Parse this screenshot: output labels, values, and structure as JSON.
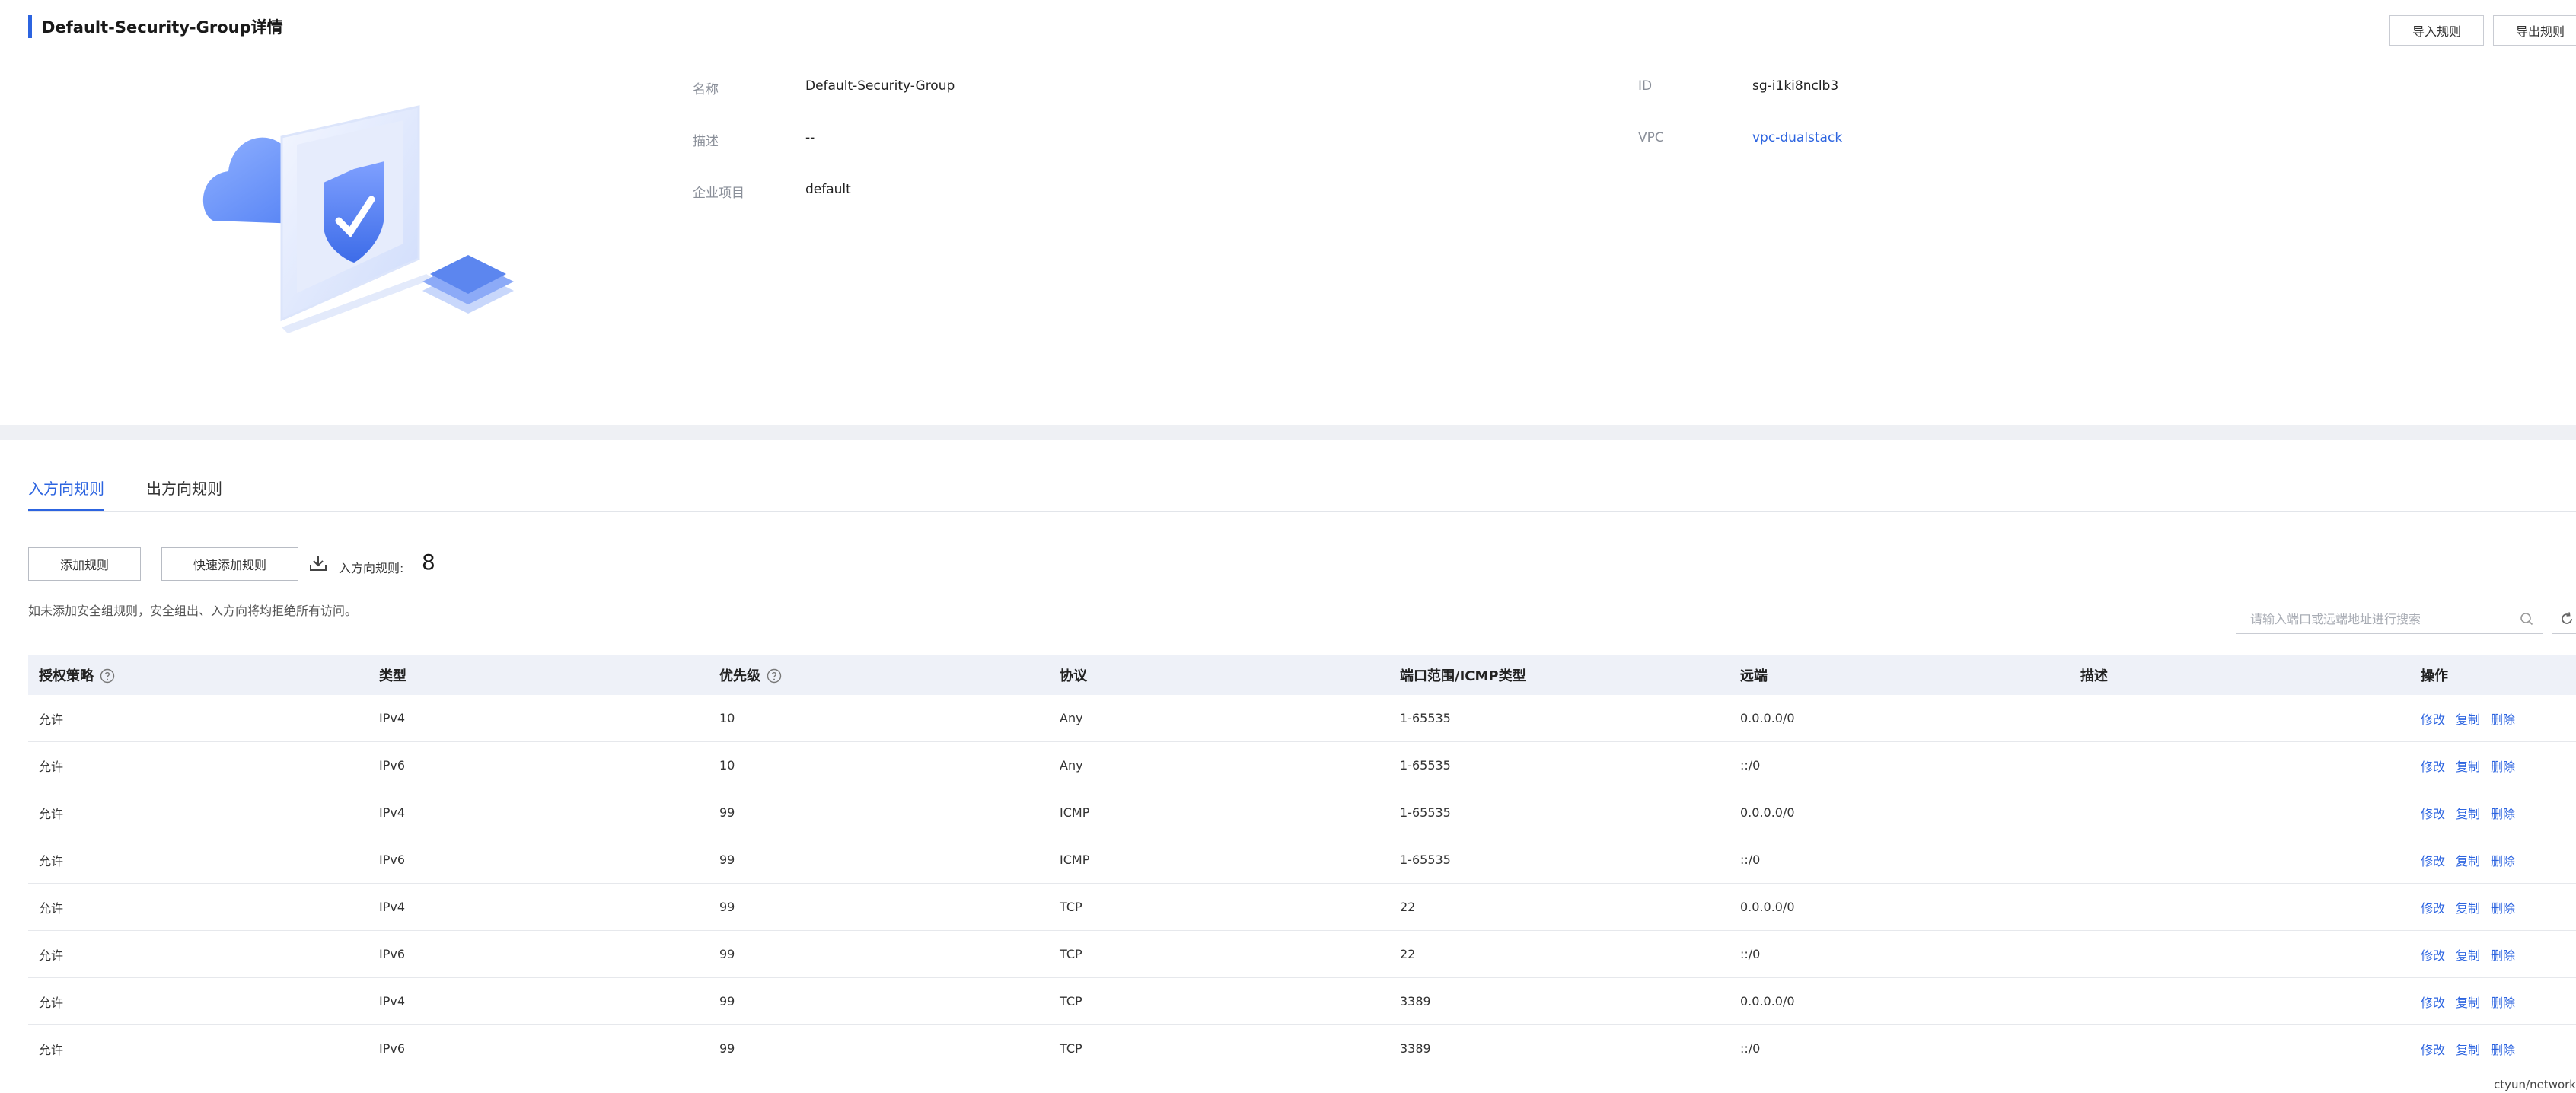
{
  "header": {
    "title": "Default-Security-Group详情",
    "import_label": "导入规则",
    "export_label": "导出规则"
  },
  "details": {
    "name_label": "名称",
    "name_value": "Default-Security-Group",
    "desc_label": "描述",
    "desc_value": "--",
    "project_label": "企业项目",
    "project_value": "default",
    "id_label": "ID",
    "id_value": "sg-i1ki8nclb3",
    "vpc_label": "VPC",
    "vpc_value": "vpc-dualstack"
  },
  "tabs": [
    {
      "label": "入方向规则",
      "active": true
    },
    {
      "label": "出方向规则",
      "active": false
    }
  ],
  "toolbar": {
    "add_label": "添加规则",
    "quick_add_label": "快速添加规则",
    "count_label": "入方向规则:",
    "count_value": "8",
    "hint": "如未添加安全组规则，安全组出、入方向将均拒绝所有访问。",
    "search_placeholder": "请输入端口或远端地址进行搜索"
  },
  "table": {
    "headers": [
      "授权策略",
      "类型",
      "优先级",
      "协议",
      "端口范围/ICMP类型",
      "远端",
      "描述",
      "操作"
    ],
    "ops": [
      "修改",
      "复制",
      "删除"
    ],
    "rows": [
      [
        "允许",
        "IPv4",
        "10",
        "Any",
        "1-65535",
        "0.0.0.0/0",
        ""
      ],
      [
        "允许",
        "IPv6",
        "10",
        "Any",
        "1-65535",
        "::/0",
        ""
      ],
      [
        "允许",
        "IPv4",
        "99",
        "ICMP",
        "1-65535",
        "0.0.0.0/0",
        ""
      ],
      [
        "允许",
        "IPv6",
        "99",
        "ICMP",
        "1-65535",
        "::/0",
        ""
      ],
      [
        "允许",
        "IPv4",
        "99",
        "TCP",
        "22",
        "0.0.0.0/0",
        ""
      ],
      [
        "允许",
        "IPv6",
        "99",
        "TCP",
        "22",
        "::/0",
        ""
      ],
      [
        "允许",
        "IPv4",
        "99",
        "TCP",
        "3389",
        "0.0.0.0/0",
        ""
      ],
      [
        "允许",
        "IPv6",
        "99",
        "TCP",
        "3389",
        "::/0",
        ""
      ]
    ]
  },
  "footer": {
    "text": "ctyun/network"
  },
  "colors": {
    "accent": "#2c64e0",
    "header_bg": "#eef1f8"
  }
}
